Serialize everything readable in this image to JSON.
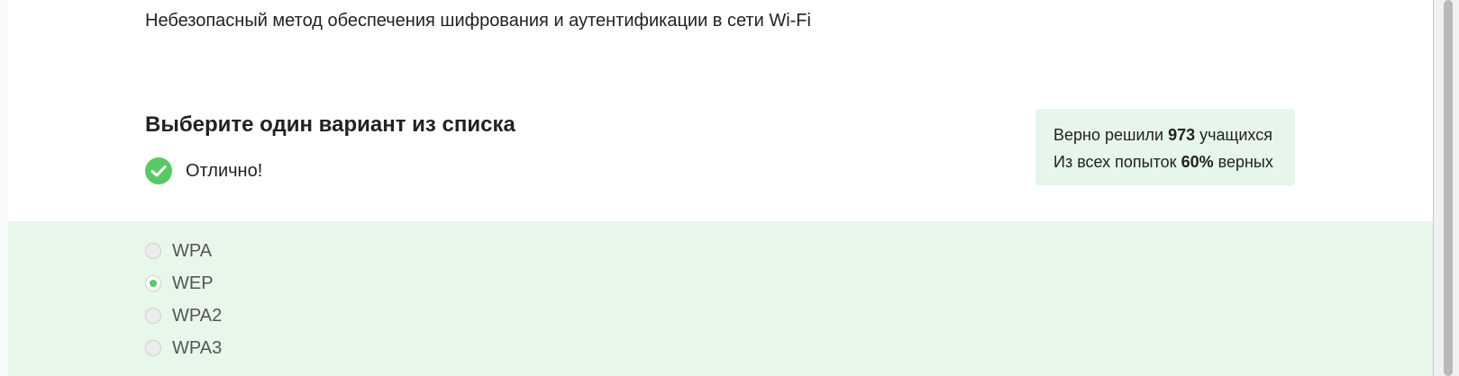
{
  "question": {
    "text": "Небезопасный метод обеспечения шифрования и аутентификации в сети Wi-Fi"
  },
  "instruction": "Выберите один вариант из списка",
  "result": {
    "icon": "check-circle-icon",
    "text": "Отлично!"
  },
  "stats": {
    "line1_prefix": "Верно решили",
    "solved_count": "973",
    "line1_suffix": "учащихся",
    "line2_prefix": "Из всех попыток",
    "percent_correct": "60%",
    "line2_suffix": "верных"
  },
  "options": [
    {
      "label": "WPA",
      "selected": false
    },
    {
      "label": "WEP",
      "selected": true
    },
    {
      "label": "WPA2",
      "selected": false
    },
    {
      "label": "WPA3",
      "selected": false
    }
  ],
  "colors": {
    "accent_green": "#58c964",
    "panel_background": "#e7f7ea",
    "stats_background": "#e7f6ea"
  }
}
